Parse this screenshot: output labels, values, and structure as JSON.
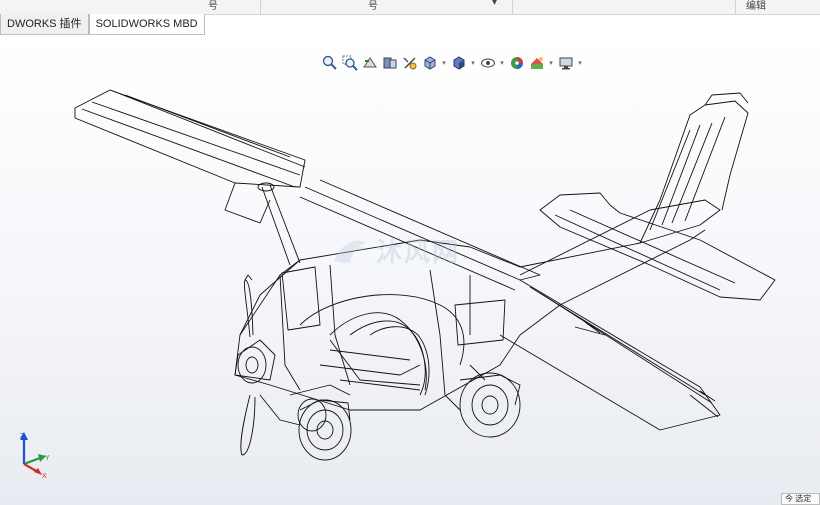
{
  "header": {
    "cells": [
      "号",
      "号",
      "编辑"
    ],
    "dropdown_glyph": "▾"
  },
  "tabs": [
    {
      "label": "DWORKS 插件",
      "active": false
    },
    {
      "label": "SOLIDWORKS MBD",
      "active": true
    }
  ],
  "heads_up_toolbar": [
    {
      "icon": "zoom-to-fit-icon"
    },
    {
      "icon": "zoom-to-area-icon"
    },
    {
      "icon": "previous-view-icon"
    },
    {
      "icon": "section-view-icon"
    },
    {
      "icon": "dynamic-annotation-icon"
    },
    {
      "icon": "view-orientation-icon",
      "dropdown": true
    },
    {
      "icon": "display-style-icon",
      "dropdown": true
    },
    {
      "icon": "hide-show-items-icon",
      "dropdown": true
    },
    {
      "icon": "edit-appearance-icon"
    },
    {
      "icon": "apply-scene-icon",
      "dropdown": true
    },
    {
      "icon": "view-settings-icon",
      "dropdown": true
    }
  ],
  "watermark": {
    "text": "沐风网"
  },
  "triad": {
    "x": "X",
    "y": "Y",
    "z": "Z"
  },
  "corner_tag": {
    "text": "今 选定"
  },
  "colors": {
    "tab_border": "#bdbdbd",
    "viewport_bottom": "#e8ebf1",
    "wire": "#111111"
  }
}
